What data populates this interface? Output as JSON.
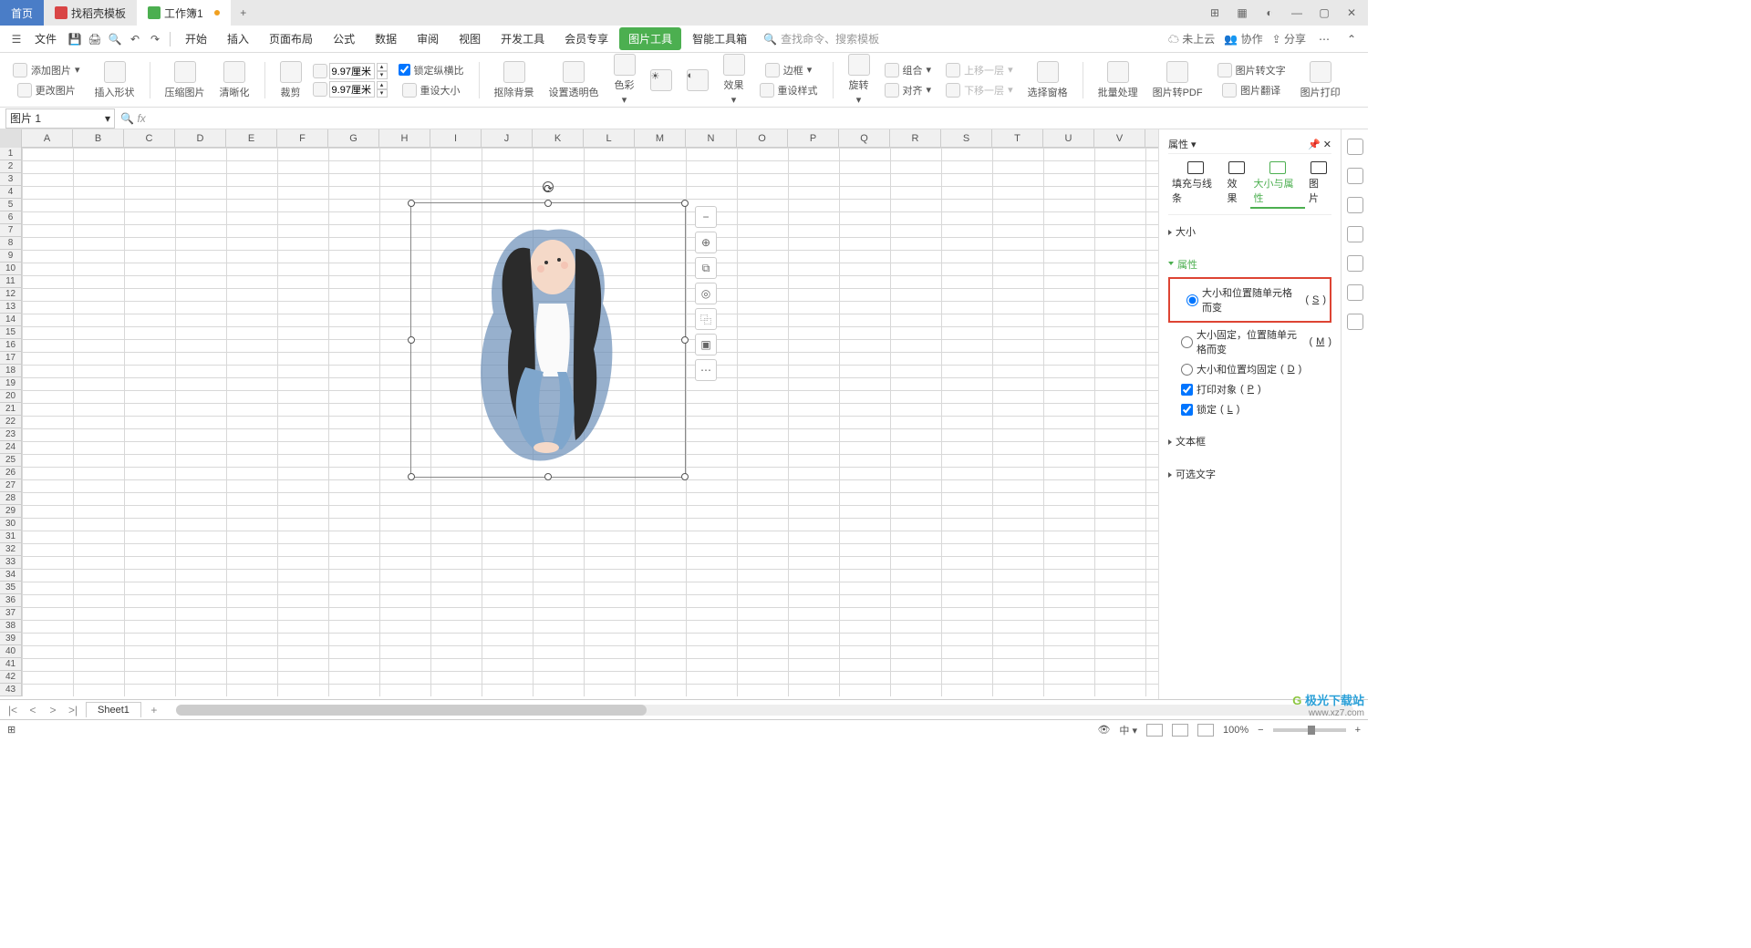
{
  "tabs": {
    "home": "首页",
    "templates": "找稻壳模板",
    "workbook": "工作簿1"
  },
  "menubar": {
    "file": "文件",
    "items": [
      "开始",
      "插入",
      "页面布局",
      "公式",
      "数据",
      "审阅",
      "视图",
      "开发工具",
      "会员专享",
      "图片工具",
      "智能工具箱"
    ],
    "active_idx": 9,
    "search_placeholder": "查找命令、搜索模板",
    "right": {
      "uncloud": "未上云",
      "coop": "协作",
      "share": "分享"
    }
  },
  "ribbon": {
    "add_image": "添加图片",
    "change_image": "更改图片",
    "insert_shape": "插入形状",
    "compress": "压缩图片",
    "clarity": "清晰化",
    "crop": "裁剪",
    "width": "9.97厘米",
    "height": "9.97厘米",
    "lock_ratio": "锁定纵横比",
    "reset_size": "重设大小",
    "remove_bg": "抠除背景",
    "transparency": "设置透明色",
    "color": "色彩",
    "effect": "效果",
    "reset_style": "重设样式",
    "border": "边框",
    "rotate": "旋转",
    "combine": "组合",
    "align": "对齐",
    "up_layer": "上移一层",
    "down_layer": "下移一层",
    "select_pane": "选择窗格",
    "batch": "批量处理",
    "to_pdf": "图片转PDF",
    "to_text": "图片转文字",
    "translate": "图片翻译",
    "print": "图片打印"
  },
  "namebox": "图片 1",
  "formula_fx": "fx",
  "columns": [
    "A",
    "B",
    "C",
    "D",
    "E",
    "F",
    "G",
    "H",
    "I",
    "J",
    "K",
    "L",
    "M",
    "N",
    "O",
    "P",
    "Q",
    "R",
    "S",
    "T",
    "U",
    "V"
  ],
  "row_count": 43,
  "float_tools": [
    "−",
    "⊕",
    "⧉",
    "◎",
    "⿻",
    "▣",
    "⋯"
  ],
  "props": {
    "title": "属性",
    "tabs": {
      "fill": "填充与线条",
      "effect": "效果",
      "size": "大小与属性",
      "image": "图片"
    },
    "size_sec": "大小",
    "attr_sec": "属性",
    "opt1": "大小和位置随单元格而变",
    "opt1_key": "S",
    "opt2": "大小固定，位置随单元格而变",
    "opt2_key": "M",
    "opt3": "大小和位置均固定",
    "opt3_key": "D",
    "print_obj": "打印对象",
    "print_key": "P",
    "lock": "锁定",
    "lock_key": "L",
    "textbox": "文本框",
    "alt_text": "可选文字"
  },
  "sheet": {
    "name": "Sheet1"
  },
  "status": {
    "zoom": "100%"
  },
  "watermark": {
    "logo": "极光下载站",
    "url": "www.xz7.com"
  }
}
